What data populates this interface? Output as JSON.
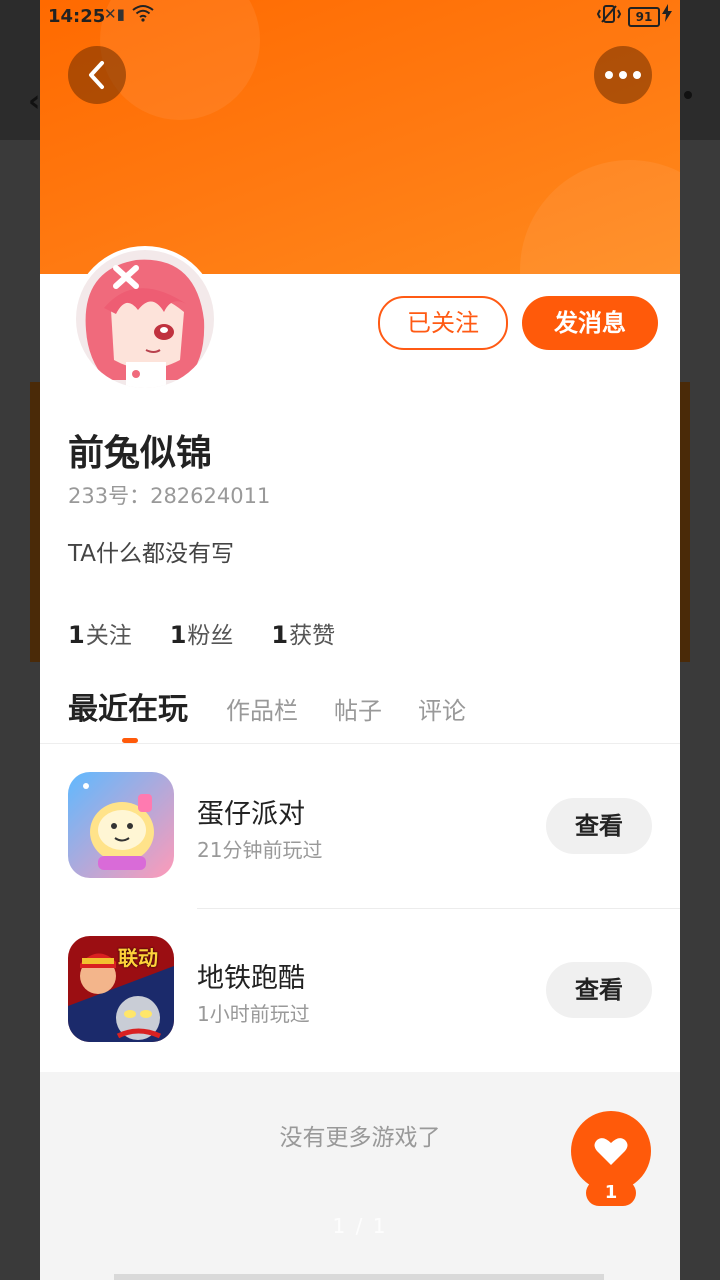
{
  "status_bar": {
    "time": "14:25",
    "battery": "91"
  },
  "header": {
    "back_icon": "chevron-left-icon",
    "more_icon": "more-horizontal-icon"
  },
  "profile": {
    "name": "前兔似锦",
    "uid": "233号：282624011",
    "bio": "TA什么都没有写",
    "follow_label": "已关注",
    "message_label": "发消息",
    "stats": [
      {
        "count": "1",
        "label": "关注"
      },
      {
        "count": "1",
        "label": "粉丝"
      },
      {
        "count": "1",
        "label": "获赞"
      }
    ]
  },
  "tabs": [
    "最近在玩",
    "作品栏",
    "帖子",
    "评论"
  ],
  "games": [
    {
      "title": "蛋仔派对",
      "subtitle": "21分钟前玩过",
      "action": "查看"
    },
    {
      "title": "地铁跑酷",
      "subtitle": "1小时前玩过",
      "action": "查看",
      "badge": "联动"
    }
  ],
  "footer": {
    "no_more": "没有更多游戏了",
    "pager": "1 / 1"
  },
  "like": {
    "count": "1"
  },
  "colors": {
    "accent": "#ff5a0a",
    "header": "#ff7a12"
  }
}
